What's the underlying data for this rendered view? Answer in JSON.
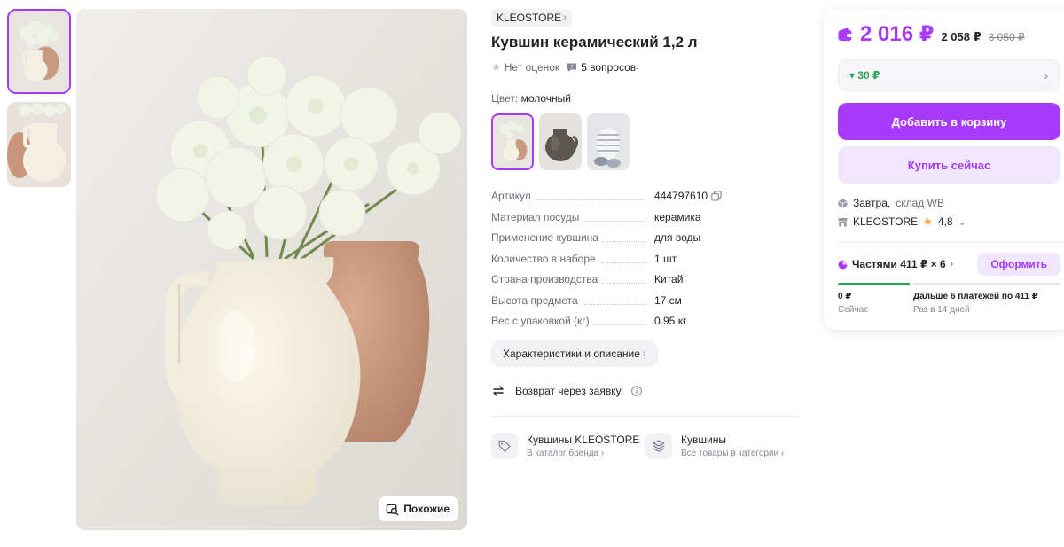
{
  "gallery": {
    "similar_label": "Похожие"
  },
  "product": {
    "brand": "KLEOSTORE",
    "title": "Кувшин керамический 1,2 л",
    "rating_text": "Нет оценок",
    "questions_text": "5 вопросов",
    "color_label": "Цвет:",
    "color_value": "молочный",
    "specs": [
      {
        "key": "Артикул",
        "value": "444797610"
      },
      {
        "key": "Материал посуды",
        "value": "керамика"
      },
      {
        "key": "Применение кувшина",
        "value": "для воды"
      },
      {
        "key": "Количество в наборе",
        "value": "1 шт."
      },
      {
        "key": "Страна производства",
        "value": "Китай"
      },
      {
        "key": "Высота предмета",
        "value": "17 см"
      },
      {
        "key": "Вес с упаковкой (кг)",
        "value": "0.95 кг"
      }
    ],
    "chars_button": "Характеристики и описание",
    "return_text": "Возврат через заявку",
    "links": [
      {
        "title": "Кувшины KLEOSTORE",
        "sub": "В каталог бренда"
      },
      {
        "title": "Кувшины",
        "sub": "Все товары в категории"
      }
    ]
  },
  "buy": {
    "price_main": "2 016 ₽",
    "price_secondary": "2 058 ₽",
    "price_old": "3 050 ₽",
    "discount": "30 ₽",
    "add_to_cart": "Добавить в корзину",
    "buy_now": "Купить сейчас",
    "delivery": "Завтра,",
    "warehouse": "склад WB",
    "seller": "KLEOSTORE",
    "seller_rating": "4,8",
    "installments": "Частями 411 ₽ × 6",
    "installments_button": "Оформить",
    "pay_now_amount": "0 ₽",
    "pay_now_label": "Сейчас",
    "pay_later_amount": "Дальше 6 платежей по 411 ₽",
    "pay_later_label": "Раз в 14 дней"
  },
  "colors": {
    "accent": "#a73afd",
    "accent_light": "#f1e6ff",
    "success": "#2ea255",
    "text": "#242424",
    "muted": "#868695"
  }
}
